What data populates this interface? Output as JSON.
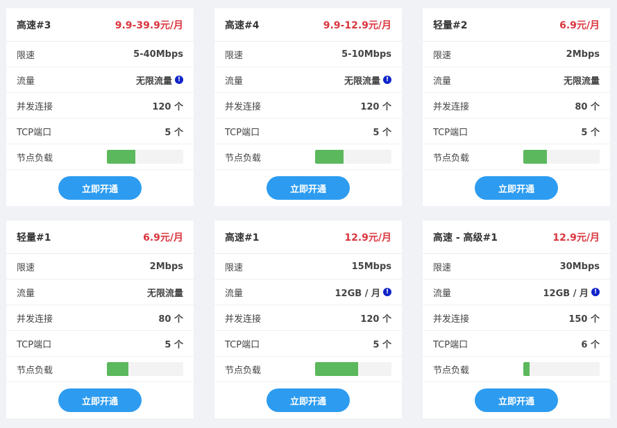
{
  "colors": {
    "price": "#d9363e",
    "button": "#2d9cf0",
    "load": "#5cb85c",
    "info_icon": "#1024c9"
  },
  "labels": {
    "speed": "限速",
    "traffic": "流量",
    "connections": "并发连接",
    "tcp_ports": "TCP端口",
    "load": "节点负载",
    "button": "立即开通"
  },
  "plans": [
    {
      "title": "高速#3",
      "price": "9.9-39.9元/月",
      "speed": "5-40Mbps",
      "traffic": "无限流量",
      "traffic_info": "!",
      "connections": "120 个",
      "tcp_ports": "5 个",
      "load": 0.37
    },
    {
      "title": "高速#4",
      "price": "9.9-12.9元/月",
      "speed": "5-10Mbps",
      "traffic": "无限流量",
      "traffic_info": "!",
      "connections": "120 个",
      "tcp_ports": "5 个",
      "load": 0.37
    },
    {
      "title": "轻量#2",
      "price": "6.9元/月",
      "speed": "2Mbps",
      "traffic": "无限流量",
      "traffic_info": "",
      "connections": "80 个",
      "tcp_ports": "5 个",
      "load": 0.31
    },
    {
      "title": "轻量#1",
      "price": "6.9元/月",
      "speed": "2Mbps",
      "traffic": "无限流量",
      "traffic_info": "",
      "connections": "80 个",
      "tcp_ports": "5 个",
      "load": 0.28
    },
    {
      "title": "高速#1",
      "price": "12.9元/月",
      "speed": "15Mbps",
      "traffic": "12GB / 月",
      "traffic_info": "!",
      "connections": "120 个",
      "tcp_ports": "5 个",
      "load": 0.56
    },
    {
      "title": "高速 - 高级#1",
      "price": "12.9元/月",
      "speed": "30Mbps",
      "traffic": "12GB / 月",
      "traffic_info": "!",
      "connections": "150 个",
      "tcp_ports": "6 个",
      "load": 0.08
    }
  ]
}
